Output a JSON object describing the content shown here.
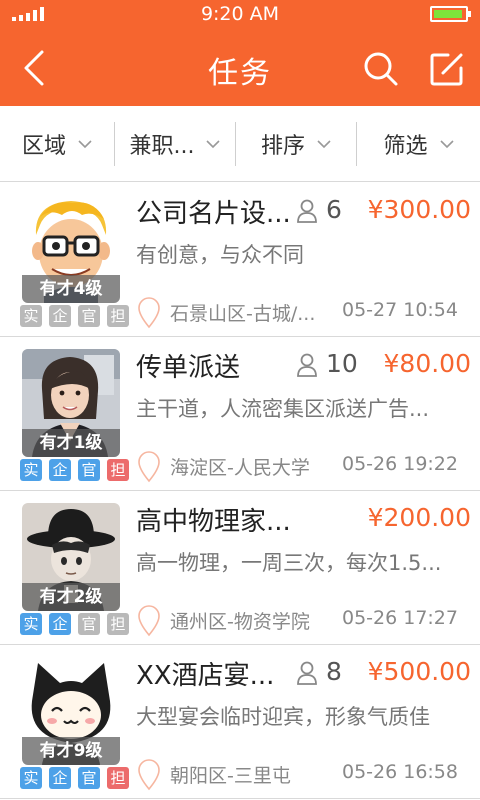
{
  "status_bar": {
    "time": "9:20 AM",
    "battery_level": 0.85
  },
  "nav": {
    "title": "任务",
    "icons": [
      "back-icon",
      "search-icon",
      "edit-icon"
    ]
  },
  "filters": [
    {
      "label": "区域"
    },
    {
      "label": "兼职..."
    },
    {
      "label": "排序"
    },
    {
      "label": "筛选"
    }
  ],
  "colors": {
    "accent": "#f6652f",
    "tag_blue": "#4da1e8",
    "tag_gray": "#b9b9b9",
    "tag_red": "#ec6b6b"
  },
  "tag_labels": [
    "实",
    "企",
    "官",
    "担"
  ],
  "tasks": [
    {
      "title": "公司名片设...",
      "headcount": "6",
      "price": "¥300.00",
      "desc": "有创意，与众不同",
      "location": "石景山区-古城/...",
      "time": "05-27 10:54",
      "level": "有才4级",
      "avatar": "cartoon-glasses-avatar",
      "tags_active": [
        false,
        false,
        false,
        false
      ]
    },
    {
      "title": "传单派送",
      "headcount": "10",
      "price": "¥80.00",
      "desc": "主干道，人流密集区派送广告...",
      "location": "海淀区-人民大学",
      "time": "05-26 19:22",
      "level": "有才1级",
      "avatar": "woman-photo-avatar",
      "tags_active": [
        true,
        true,
        true,
        true
      ]
    },
    {
      "title": "高中物理家...",
      "headcount": "",
      "price": "¥200.00",
      "desc": "高一物理，一周三次，每次1.5...",
      "location": "通州区-物资学院",
      "time": "05-26 17:27",
      "level": "有才2级",
      "avatar": "hat-figure-avatar",
      "tags_active": [
        true,
        true,
        false,
        false
      ]
    },
    {
      "title": "XX酒店宴...",
      "headcount": "8",
      "price": "¥500.00",
      "desc": "大型宴会临时迎宾，形象气质佳",
      "location": "朝阳区-三里屯",
      "time": "05-26 16:58",
      "level": "有才9级",
      "avatar": "cat-costume-avatar",
      "tags_active": [
        true,
        true,
        true,
        true
      ]
    }
  ]
}
